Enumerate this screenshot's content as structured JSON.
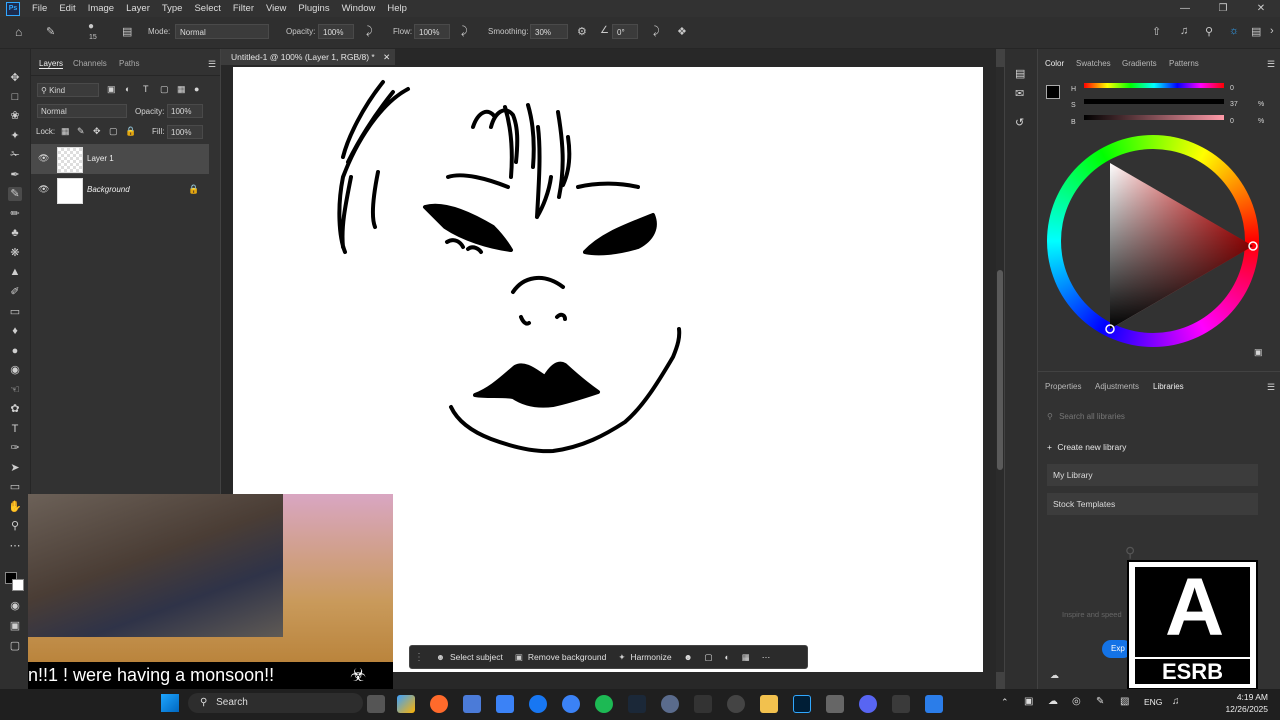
{
  "menu": [
    "File",
    "Edit",
    "Image",
    "Layer",
    "Type",
    "Select",
    "Filter",
    "View",
    "Plugins",
    "Window",
    "Help"
  ],
  "options": {
    "brush_size": "15",
    "mode_label": "Mode:",
    "mode_value": "Normal",
    "opacity_label": "Opacity:",
    "opacity_value": "100%",
    "flow_label": "Flow:",
    "flow_value": "100%",
    "smoothing_label": "Smoothing:",
    "smoothing_value": "30%",
    "angle_value": "0°"
  },
  "layers_panel": {
    "tabs": [
      "Layers",
      "Channels",
      "Paths"
    ],
    "filter_kind": "Kind",
    "blend_mode": "Normal",
    "opacity_label": "Opacity:",
    "opacity_value": "100%",
    "lock_label": "Lock:",
    "fill_label": "Fill:",
    "fill_value": "100%",
    "layers": [
      {
        "name": "Layer 1"
      },
      {
        "name": "Background"
      }
    ]
  },
  "document": {
    "tab_title": "Untitled-1 @ 100% (Layer 1, RGB/8) *"
  },
  "color_panel": {
    "tabs": [
      "Color",
      "Swatches",
      "Gradients",
      "Patterns"
    ],
    "sliders": [
      {
        "label": "H",
        "value": "0",
        "unit": ""
      },
      {
        "label": "S",
        "value": "37",
        "unit": "%"
      },
      {
        "label": "B",
        "value": "0",
        "unit": "%"
      }
    ]
  },
  "lib_panel": {
    "tabs": [
      "Properties",
      "Adjustments",
      "Libraries"
    ],
    "search_placeholder": "Search all libraries",
    "create_label": "Create new library",
    "items": [
      "My Library",
      "Stock Templates"
    ],
    "hint": "Inspire and speed",
    "button_label": "Exp"
  },
  "context_bar": {
    "select_subject": "Select subject",
    "remove_background": "Remove background",
    "harmonize": "Harmonize"
  },
  "overlay": {
    "caption": "n!!1 !    were having a monsoon!!",
    "esrb": "ESRB"
  },
  "taskbar": {
    "search_label": "Search",
    "lang": "ENG",
    "time": "4:19 AM",
    "date": "12/26/2025"
  },
  "colors": {
    "accent": "#31a8ff",
    "foreground_color": "#000000",
    "background_color": "#ffffff"
  }
}
